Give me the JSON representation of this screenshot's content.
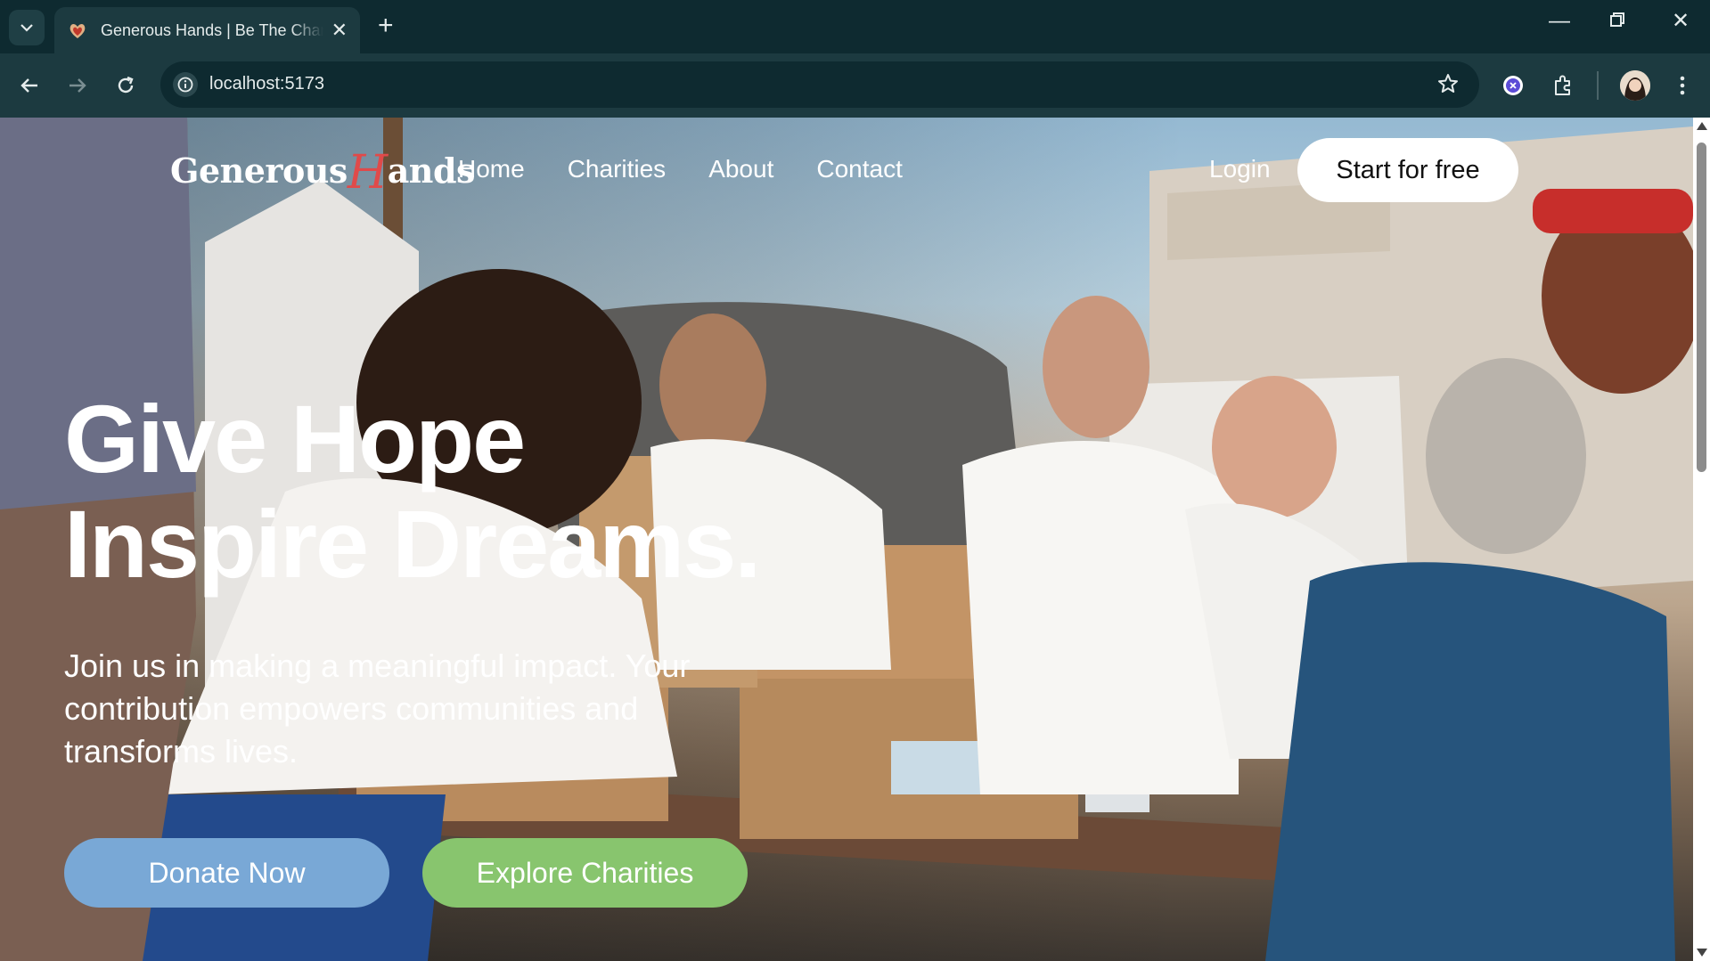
{
  "browser": {
    "tab_title": "Generous Hands | Be The Change",
    "url": "localhost:5173",
    "icons": [
      "tab-search-icon",
      "favicon-icon",
      "close-icon",
      "new-tab-icon",
      "minimize-icon",
      "restore-icon",
      "window-close-icon",
      "back-icon",
      "forward-icon",
      "reload-icon",
      "site-info-icon",
      "bookmark-star-icon",
      "extension-icon",
      "puzzle-icon",
      "profile-avatar",
      "menu-kebab-icon"
    ]
  },
  "site": {
    "logo_prefix": "Generous",
    "logo_h": "H",
    "logo_suffix": "ands",
    "nav": [
      "Home",
      "Charities",
      "About",
      "Contact"
    ],
    "login": "Login",
    "cta": "Start for free"
  },
  "hero": {
    "title_line1": "Give Hope",
    "title_line2": "Inspire Dreams.",
    "subtitle": "Join us in making a meaningful impact. Your contribution empowers communities and transforms lives.",
    "donate_button": "Donate Now",
    "explore_button": "Explore Charities"
  },
  "colors": {
    "chrome_dark": "#0e2a30",
    "chrome_toolbar": "#1c3a40",
    "logo_accent": "#e04a4a",
    "donate_bg": "#79a8d6",
    "explore_bg": "#88c56e"
  }
}
